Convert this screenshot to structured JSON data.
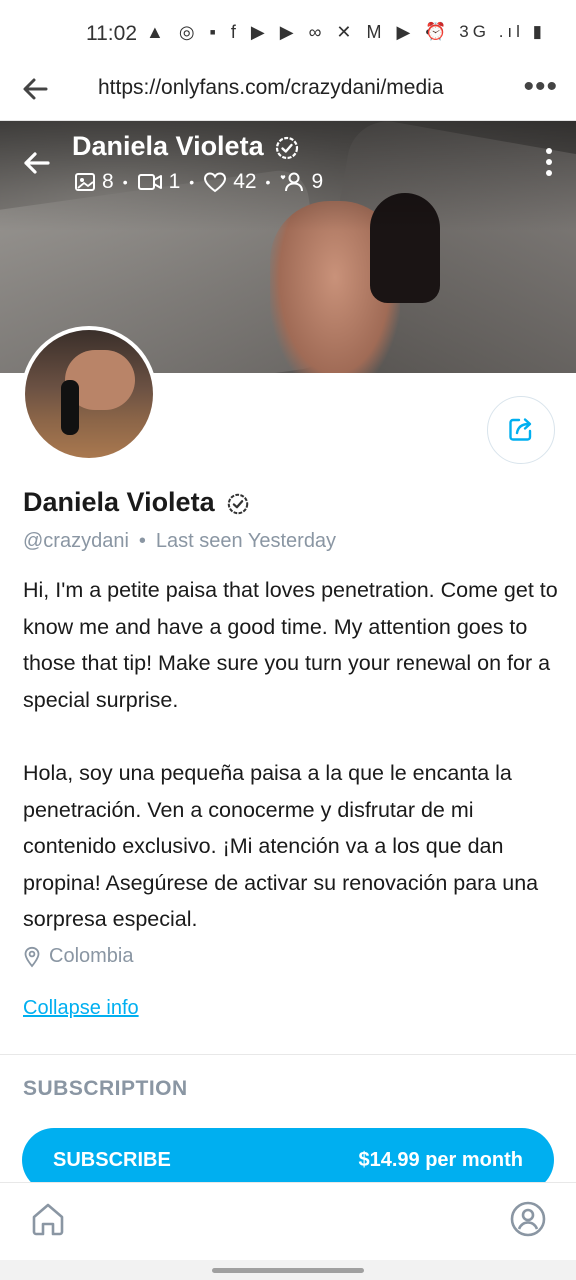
{
  "status_bar": {
    "time": "11:02",
    "left_icons": "▲ ◎ ▪ f ▶ ▶ ∞ ✕ M ▶ •",
    "right_icons": "⏰ 3G .ıl ▮"
  },
  "browser": {
    "url": "https://onlyfans.com/crazydani/media",
    "more": "•••"
  },
  "cover": {
    "name": "Daniela Violeta",
    "stats": {
      "photos": "8",
      "videos": "1",
      "likes": "42",
      "fans": "9"
    }
  },
  "profile": {
    "name": "Daniela Violeta",
    "handle": "@crazydani",
    "separator": "•",
    "last_seen": "Last seen Yesterday",
    "bio_en": "Hi, I'm a petite paisa that loves penetration. Come get to know me and have a good time. My attention goes to those that tip! Make sure you turn your renewal on for a special surprise.",
    "bio_es": "Hola, soy una pequeña paisa a la que le encanta la penetración. Ven a conocerme y disfrutar de mi contenido exclusivo. ¡Mi atención va a los que dan propina! Asegúrese de activar su renovación para una sorpresa especial.",
    "location": "Colombia",
    "collapse_label": "Collapse info"
  },
  "subscription": {
    "section_title": "SUBSCRIPTION",
    "button_label": "SUBSCRIBE",
    "price": "$14.99 per month"
  },
  "colors": {
    "accent": "#00aff0",
    "muted_text": "#8a96a3"
  }
}
